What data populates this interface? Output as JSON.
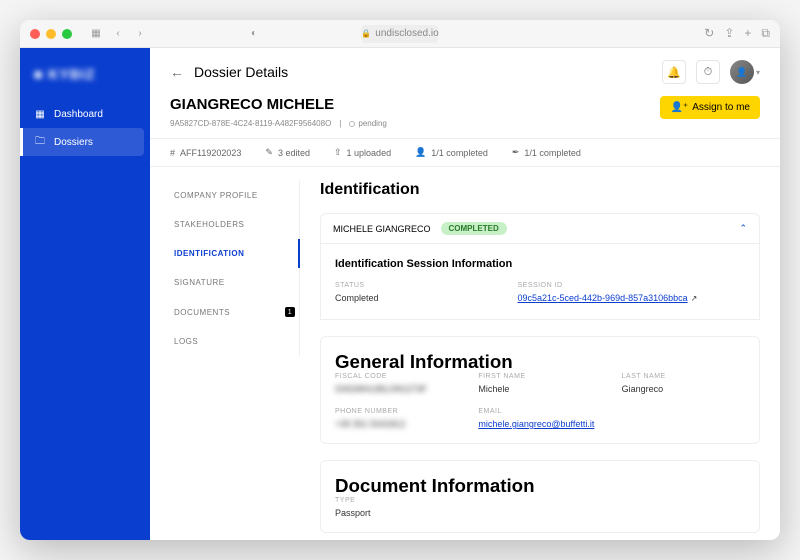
{
  "browser": {
    "url": "undisclosed.io"
  },
  "logo": "■ KYBIZ",
  "nav": {
    "dashboard": "Dashboard",
    "dossiers": "Dossiers"
  },
  "header": {
    "title": "Dossier Details",
    "assign": "Assign to me"
  },
  "subject": {
    "name": "GIANGRECO MICHELE",
    "id": "9A5827CD-878E-4C24-8119-A482F956408O",
    "status": "pending"
  },
  "stats": {
    "ref": "AFF119202023",
    "edited": "3 edited",
    "uploaded": "1 uploaded",
    "completed1": "1/1 completed",
    "completed2": "1/1 completed"
  },
  "sections": {
    "company": "COMPANY PROFILE",
    "stakeholders": "STAKEHOLDERS",
    "identification": "IDENTIFICATION",
    "signature": "SIGNATURE",
    "documents": "DOCUMENTS",
    "documents_badge": "1",
    "logs": "LOGS"
  },
  "detail": {
    "title": "Identification",
    "person": "MICHELE GIANGRECO",
    "chip": "COMPLETED",
    "session": {
      "heading": "Identification Session Information",
      "status_label": "STATUS",
      "status_value": "Completed",
      "sid_label": "SESSION ID",
      "sid_value": "09c5a21c-5ced-442b-969d-857a3106bbca"
    },
    "general": {
      "heading": "General Information",
      "fiscal_label": "FISCAL CODE",
      "fiscal_value": "GNGMHL85L09G273F",
      "first_label": "FIRST NAME",
      "first_value": "Michele",
      "last_label": "LAST NAME",
      "last_value": "Giangreco",
      "phone_label": "PHONE NUMBER",
      "phone_value": "+39 351 5041812",
      "email_label": "EMAIL",
      "email_value": "michele.giangreco@buffetti.it"
    },
    "document": {
      "heading": "Document Information",
      "type_label": "TYPE",
      "type_value": "Passport"
    }
  }
}
